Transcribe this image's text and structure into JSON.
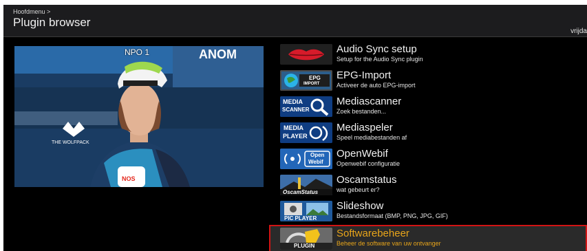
{
  "header": {
    "breadcrumb": "Hoofdmenu >",
    "title": "Plugin browser",
    "date_fragment": "vrijda"
  },
  "preview": {
    "channel": "NPO 1"
  },
  "colors": {
    "selection_border": "#d21414",
    "selection_text": "#e8a51a",
    "background": "#000000"
  },
  "plugins": [
    {
      "name": "Audio Sync setup",
      "description": "Setup for the Audio Sync plugin",
      "icon": "lips-icon",
      "logo_text": ""
    },
    {
      "name": "EPG-Import",
      "description": "Activeer de auto EPG-import",
      "icon": "epg-globe-icon",
      "logo_text": "EPG",
      "logo_text2": "IMPORT"
    },
    {
      "name": "Mediascanner",
      "description": "Zoek bestanden...",
      "icon": "magnifier-icon",
      "logo_text": "MEDIA",
      "logo_text2": "SCANNER"
    },
    {
      "name": "Mediaspeler",
      "description": "Speel mediabestanden af",
      "icon": "media-player-icon",
      "logo_text": "MEDIA",
      "logo_text2": "PLAYER"
    },
    {
      "name": "OpenWebif",
      "description": "Openwebif configuratie",
      "icon": "openwebif-icon",
      "logo_text": "Open",
      "logo_text2": "Webif"
    },
    {
      "name": "Oscamstatus",
      "description": "wat gebeurt er?",
      "icon": "oscam-status-icon",
      "logo_text": "OscamStatus"
    },
    {
      "name": "Slideshow",
      "description": "Bestandsformaat (BMP, PNG, JPG, GIF)",
      "icon": "pic-player-icon",
      "logo_text": "PIC PLAYER"
    },
    {
      "name": "Softwarebeheer",
      "description": "Beheer de software van uw ontvanger",
      "icon": "plugin-icon",
      "logo_text": "PLUGIN",
      "selected": true
    }
  ]
}
